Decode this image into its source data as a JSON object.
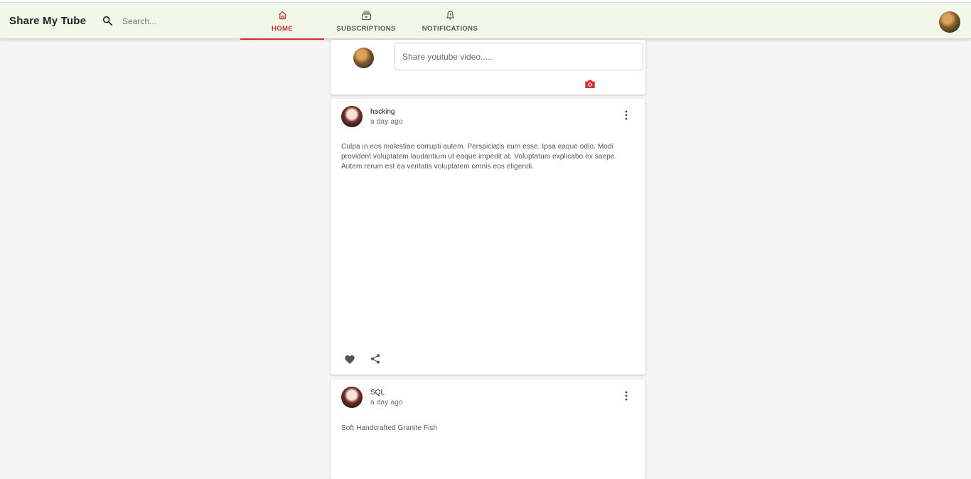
{
  "app": {
    "title": "Share My Tube",
    "accent_color": "#d32f2f",
    "appbar_color": "#f1f8e9"
  },
  "search": {
    "placeholder": "Search...",
    "icon": "search-icon"
  },
  "tabs": [
    {
      "label": "HOME",
      "icon": "home-icon",
      "active": true
    },
    {
      "label": "SUBSCRIPTIONS",
      "icon": "subscriptions-icon",
      "active": false
    },
    {
      "label": "NOTIFICATIONS",
      "icon": "bell-icon",
      "active": false
    }
  ],
  "compose": {
    "placeholder": "Share youtube video.....",
    "camera_icon": "camera-icon"
  },
  "posts": [
    {
      "title": "hacking",
      "time": "a day ago",
      "body": "Culpa in eos molestiae corrupti autem. Perspiciatis eum esse. Ipsa eaque odio. Modi provident voluptatem laudantium ut eaque impedit at. Voluptatum explicabo ex saepe. Autem rerum est ea veritatis voluptatem omnis eos eligendi."
    },
    {
      "title": "SQL",
      "time": "a day ago",
      "body": "Soft Handcrafted Granite Fish"
    }
  ]
}
